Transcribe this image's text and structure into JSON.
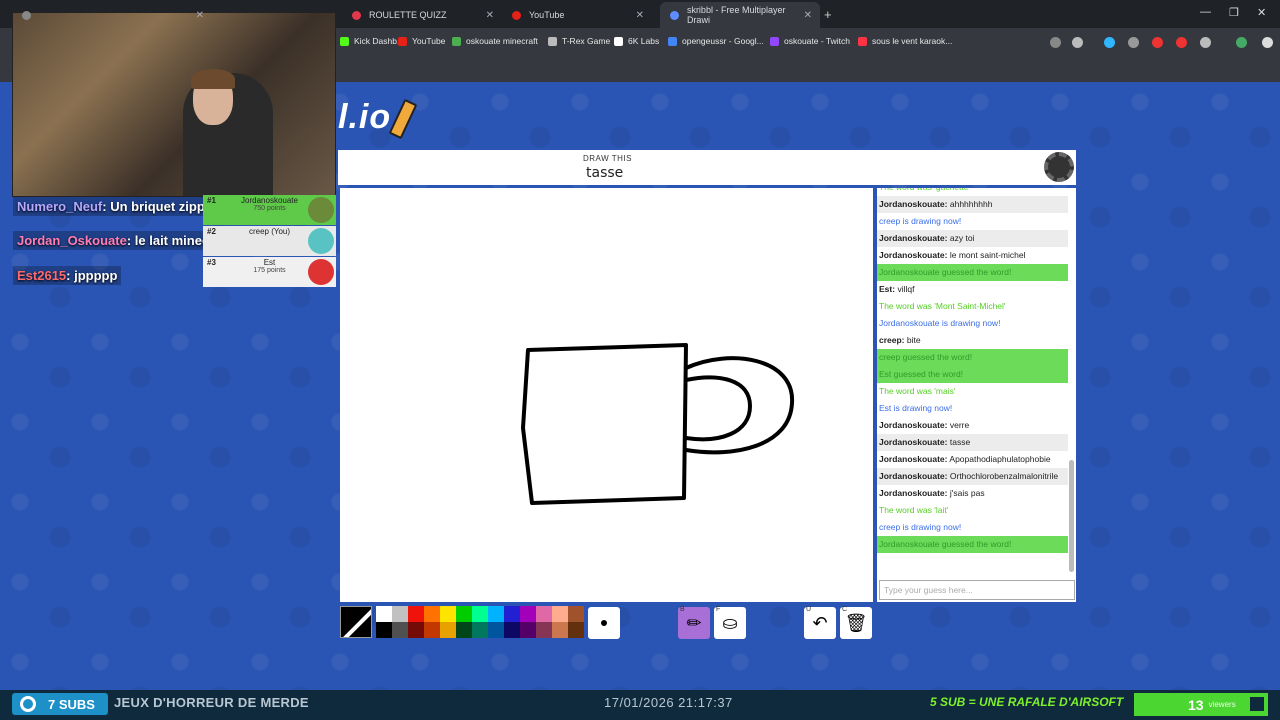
{
  "browser": {
    "tabs": [
      {
        "label": "",
        "active": false,
        "favicon": "#888888",
        "closable": true
      },
      {
        "label": "ROULETTE QUIZZ",
        "active": false,
        "favicon": "#e3374b",
        "closable": true
      },
      {
        "label": "YouTube",
        "active": false,
        "favicon": "#e62117",
        "closable": true
      },
      {
        "label": "skribbl - Free Multiplayer Drawi",
        "active": true,
        "favicon": "#5f8cff",
        "closable": true
      }
    ],
    "bookmarks": [
      {
        "label": "Kick Dashb...",
        "color": "#53fc18"
      },
      {
        "label": "YouTube",
        "color": "#e62117"
      },
      {
        "label": "oskouate minecraft",
        "color": "#4caf50"
      },
      {
        "label": "T-Rex Game",
        "color": "#bbbbbb"
      },
      {
        "label": "6K Labs",
        "color": "#ffffff"
      },
      {
        "label": "opengeussr - Googl...",
        "color": "#4285f4"
      },
      {
        "label": "oskouate - Twitch",
        "color": "#9146ff"
      },
      {
        "label": "sous le vent karaok...",
        "color": "#ff3344"
      }
    ]
  },
  "game": {
    "logo_fragment": "l.io",
    "header_label": "DRAW THIS",
    "word": "tasse",
    "chat": [
      {
        "type": "greentext",
        "user": "",
        "text": "The word was 'gachette'"
      },
      {
        "type": "alt",
        "user": "Jordanoskouate:",
        "text": "ahhhhhhhh"
      },
      {
        "type": "blue",
        "user": "",
        "text": "creep is drawing now!"
      },
      {
        "type": "alt",
        "user": "Jordanoskouate:",
        "text": "azy toi"
      },
      {
        "type": "normal",
        "user": "Jordanoskouate:",
        "text": "le mont saint-michel"
      },
      {
        "type": "green",
        "user": "",
        "text": "Jordanoskouate guessed the word!"
      },
      {
        "type": "normal",
        "user": "Est:",
        "text": "villqf"
      },
      {
        "type": "greentext",
        "user": "",
        "text": "The word was 'Mont Saint-Michel'"
      },
      {
        "type": "blue",
        "user": "",
        "text": "Jordanoskouate is drawing now!"
      },
      {
        "type": "normal",
        "user": "creep:",
        "text": "bite"
      },
      {
        "type": "green",
        "user": "",
        "text": "creep guessed the word!"
      },
      {
        "type": "green",
        "user": "",
        "text": "Est guessed the word!"
      },
      {
        "type": "greentext",
        "user": "",
        "text": "The word was 'mais'"
      },
      {
        "type": "blue",
        "user": "",
        "text": "Est is drawing now!"
      },
      {
        "type": "normal",
        "user": "Jordanoskouate:",
        "text": "verre"
      },
      {
        "type": "alt",
        "user": "Jordanoskouate:",
        "text": "tasse"
      },
      {
        "type": "normal",
        "user": "Jordanoskouate:",
        "text": "Apopathodiaphulatophobie"
      },
      {
        "type": "alt",
        "user": "Jordanoskouate:",
        "text": "Orthochlorobenzalmalonitrile"
      },
      {
        "type": "normal",
        "user": "Jordanoskouate:",
        "text": "j'sais pas"
      },
      {
        "type": "greentext",
        "user": "",
        "text": "The word was 'lait'"
      },
      {
        "type": "blue",
        "user": "",
        "text": "creep is drawing now!"
      },
      {
        "type": "green",
        "user": "",
        "text": "Jordanoskouate guessed the word!"
      }
    ],
    "guess_placeholder": "Type your guess here...",
    "palette_top": [
      "#ffffff",
      "#c1c1c1",
      "#ef130b",
      "#ff7100",
      "#ffe400",
      "#00cc00",
      "#00ff91",
      "#00b2ff",
      "#231fd3",
      "#a300ba",
      "#df69a7",
      "#ffac8e",
      "#a0522d"
    ],
    "palette_bottom": [
      "#000000",
      "#505050",
      "#740b07",
      "#c23800",
      "#e8a200",
      "#004619",
      "#00785d",
      "#00569e",
      "#0e0865",
      "#550069",
      "#873554",
      "#cc774d",
      "#63300d"
    ],
    "tools": [
      {
        "key": "B",
        "icon": "pencil-icon",
        "glyph": "✏"
      },
      {
        "key": "F",
        "icon": "fill-bucket-icon",
        "glyph": "⛀"
      },
      {
        "key": "U",
        "icon": "undo-icon",
        "glyph": "↶"
      },
      {
        "key": "C",
        "icon": "trash-icon",
        "glyph": "🗑"
      }
    ]
  },
  "overlay": {
    "messages": [
      {
        "user": "Numero_Neuf",
        "text": ": Un briquet zippo",
        "color": "#b6a8ff"
      },
      {
        "user": "Jordan_Oskouate",
        "text": ": le lait minecraft c'est bon",
        "color": "#ff7eb6"
      },
      {
        "user": "Est2615",
        "text": ": jppppp",
        "color": "#ff6a6a"
      }
    ],
    "players": [
      {
        "rank": "#1",
        "name": "Jordanoskouate",
        "points": "750 points",
        "bg": "#5fc94a"
      },
      {
        "rank": "#2",
        "name": "creep (You)",
        "points": "",
        "bg": "#e8e8e8"
      },
      {
        "rank": "#3",
        "name": "Est",
        "points": "175 points",
        "bg": "#f0f0f0"
      }
    ]
  },
  "stream_bar": {
    "subs": "7 SUBS",
    "title": "JEUX D'HORREUR DE MERDE",
    "datetime": "17/01/2026 21:17:37",
    "promo": "5 SUB = UNE RAFALE D'AIRSOFT",
    "viewers": "13",
    "viewers_label": "viewers"
  }
}
